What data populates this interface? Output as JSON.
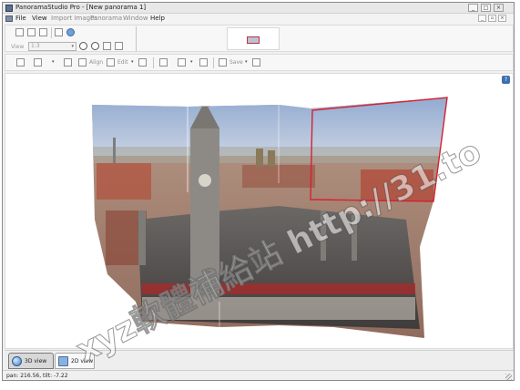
{
  "window": {
    "title": "PanoramaStudio Pro - [New panorama 1]",
    "controls": {
      "minimize": "_",
      "maximize": "□",
      "close": "×"
    }
  },
  "menu": {
    "items": [
      {
        "label": "File",
        "enabled": true
      },
      {
        "label": "View",
        "enabled": true
      },
      {
        "label": "Import Images",
        "enabled": false
      },
      {
        "label": "Panorama",
        "enabled": false
      },
      {
        "label": "Window",
        "enabled": false
      },
      {
        "label": "Help",
        "enabled": true
      }
    ],
    "mdi_controls": {
      "minimize": "_",
      "restore": "▫",
      "close": "×"
    }
  },
  "toolbar1": {
    "view_label": "View",
    "view_value": "1:3",
    "view_arrow": "▾"
  },
  "toolbar2": {
    "align_label": "Align",
    "edit_label": "Edit",
    "save_label": "Save",
    "dropdown_arrow": "▾"
  },
  "canvas": {
    "help_label": "?"
  },
  "tabs": [
    {
      "label": "3D view",
      "active": true
    },
    {
      "label": "2D view",
      "active": false
    }
  ],
  "status": {
    "text": "pan: 216.56, tilt: -7.22"
  },
  "watermark": {
    "text": "xyz軟體補給站 http://31.to"
  },
  "colors": {
    "selection_frame": "#d62030",
    "accent": "#3f6fb0"
  }
}
